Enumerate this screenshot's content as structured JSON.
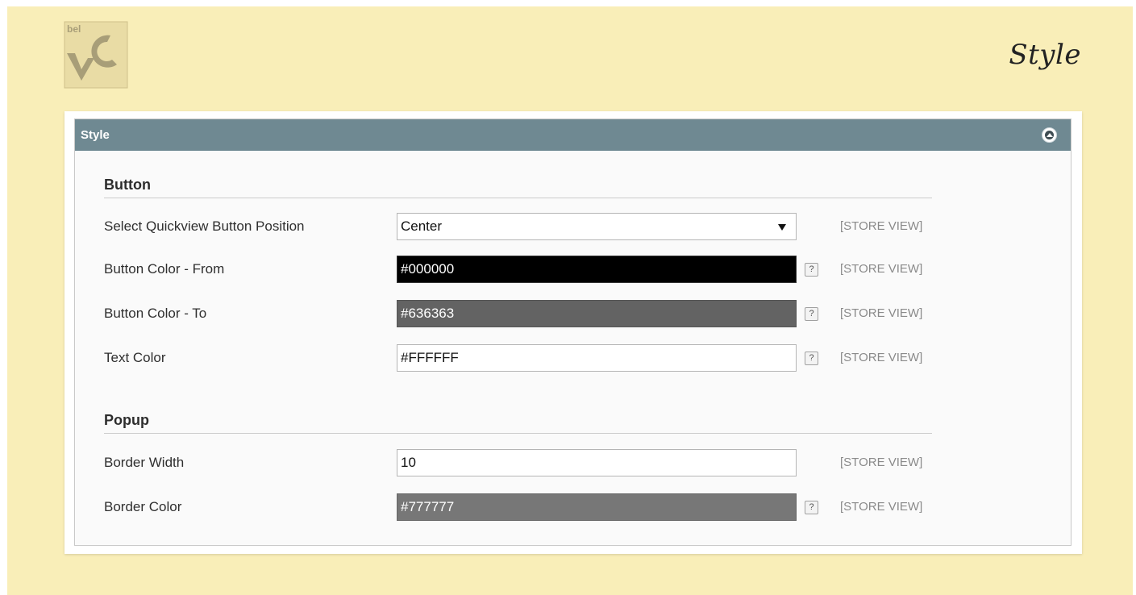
{
  "header": {
    "logo_icon": "belvg-logo",
    "title": "Style"
  },
  "fieldset": {
    "title": "Style",
    "toggle_icon": "collapse-up-icon"
  },
  "sections": {
    "button": {
      "title": "Button",
      "position": {
        "label": "Select Quickview Button Position",
        "value": "Center",
        "scope": "[STORE VIEW]"
      },
      "color_from": {
        "label": "Button Color - From",
        "value": "#000000",
        "scope": "[STORE VIEW]",
        "swatch": "#000000"
      },
      "color_to": {
        "label": "Button Color - To",
        "value": "#636363",
        "scope": "[STORE VIEW]",
        "swatch": "#636363"
      },
      "text_color": {
        "label": "Text Color",
        "value": "#FFFFFF",
        "scope": "[STORE VIEW]",
        "swatch": "#FFFFFF"
      }
    },
    "popup": {
      "title": "Popup",
      "border_width": {
        "label": "Border Width",
        "value": "10",
        "scope": "[STORE VIEW]"
      },
      "border_color": {
        "label": "Border Color",
        "value": "#777777",
        "scope": "[STORE VIEW]",
        "swatch": "#777777"
      }
    }
  },
  "help_label": "?",
  "colors": {
    "page_background": "#f9eeb8",
    "header_bar": "#6f8992",
    "scope_text": "#8a8a8a"
  }
}
